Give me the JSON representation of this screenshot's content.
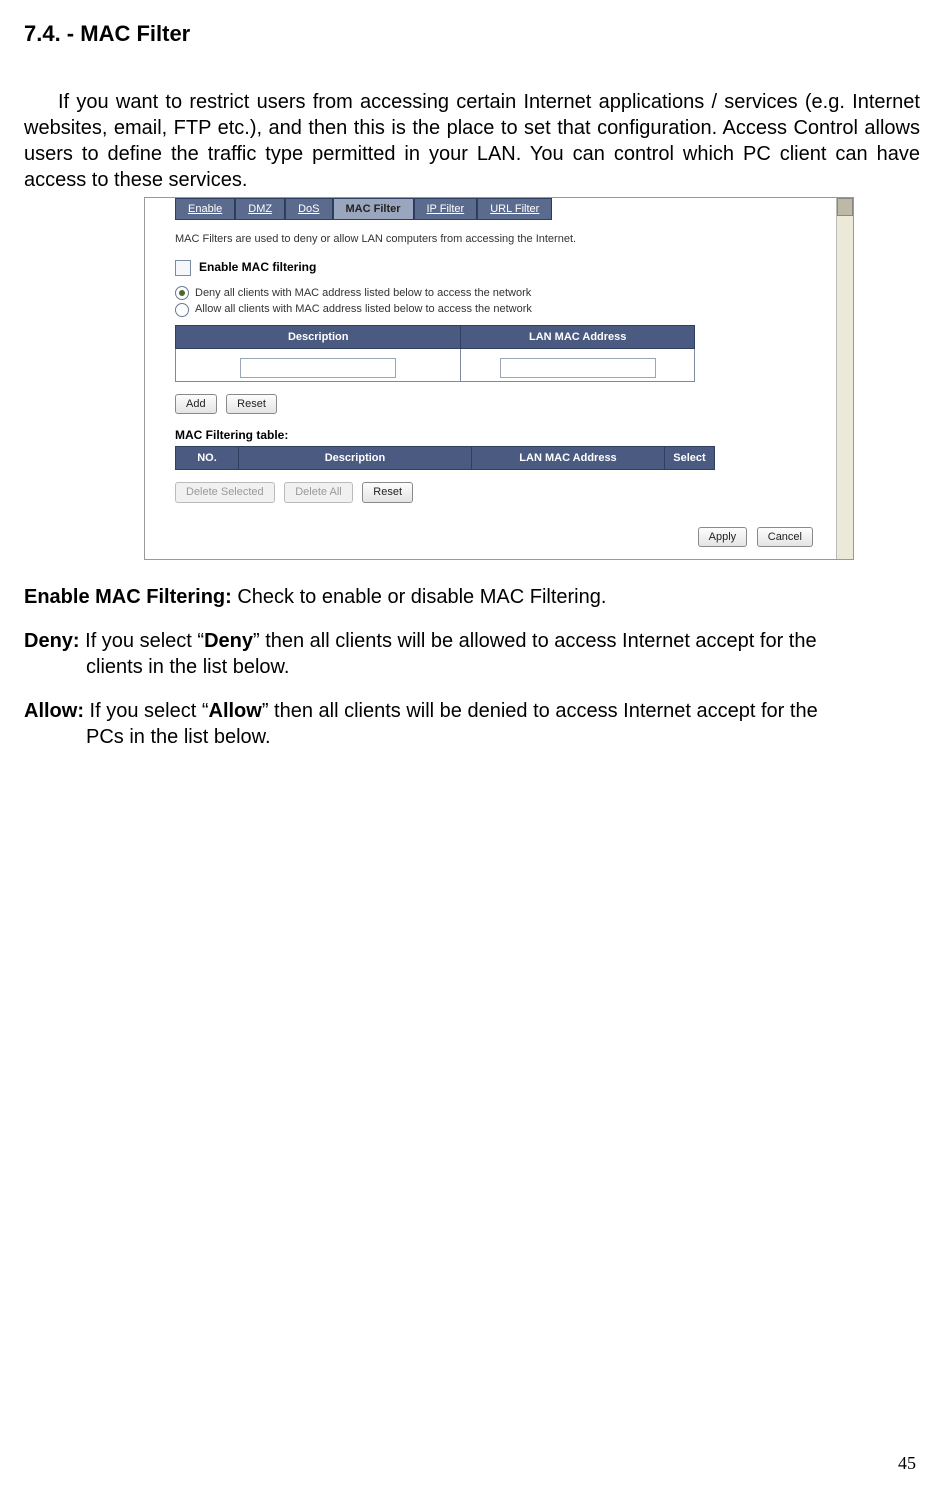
{
  "heading": "7.4. - MAC Filter",
  "intro": "If you want to restrict users from accessing certain Internet applications / services (e.g. Internet websites, email, FTP etc.), and then this is the place to set that configuration. Access Control allows users to define the traffic type permitted in your LAN. You can control which PC client can have access to these services.",
  "screenshot": {
    "tabs": [
      "Enable",
      "DMZ",
      "DoS",
      "MAC Filter",
      "IP Filter",
      "URL Filter"
    ],
    "active_tab": "MAC Filter",
    "note": "MAC Filters are used to deny or allow LAN computers from accessing the Internet.",
    "enable_label": "Enable MAC filtering",
    "radio_deny": "Deny all clients with MAC address listed below to access the network",
    "radio_allow": "Allow all clients with MAC address listed below to access the network",
    "input_headers": [
      "Description",
      "LAN MAC Address"
    ],
    "add_btn": "Add",
    "reset_btn": "Reset",
    "table_title": "MAC Filtering table:",
    "filter_headers": [
      "NO.",
      "Description",
      "LAN MAC Address",
      "Select"
    ],
    "delete_selected": "Delete Selected",
    "delete_all": "Delete All",
    "reset2": "Reset",
    "apply": "Apply",
    "cancel": "Cancel"
  },
  "defs": {
    "enable": {
      "term": "Enable MAC Filtering:",
      "text": " Check to enable or disable MAC Filtering."
    },
    "deny": {
      "term": "Deny:",
      "prefix": " If you select “",
      "bold": "Deny",
      "suffix": "” then all clients will be allowed to access Internet accept for the",
      "cont": "clients in the list below."
    },
    "allow": {
      "term": "Allow:",
      "prefix": " If you select “",
      "bold": "Allow",
      "suffix": "” then all clients will be denied to access Internet accept for the",
      "cont": "PCs in the list below."
    }
  },
  "page_number": "45"
}
